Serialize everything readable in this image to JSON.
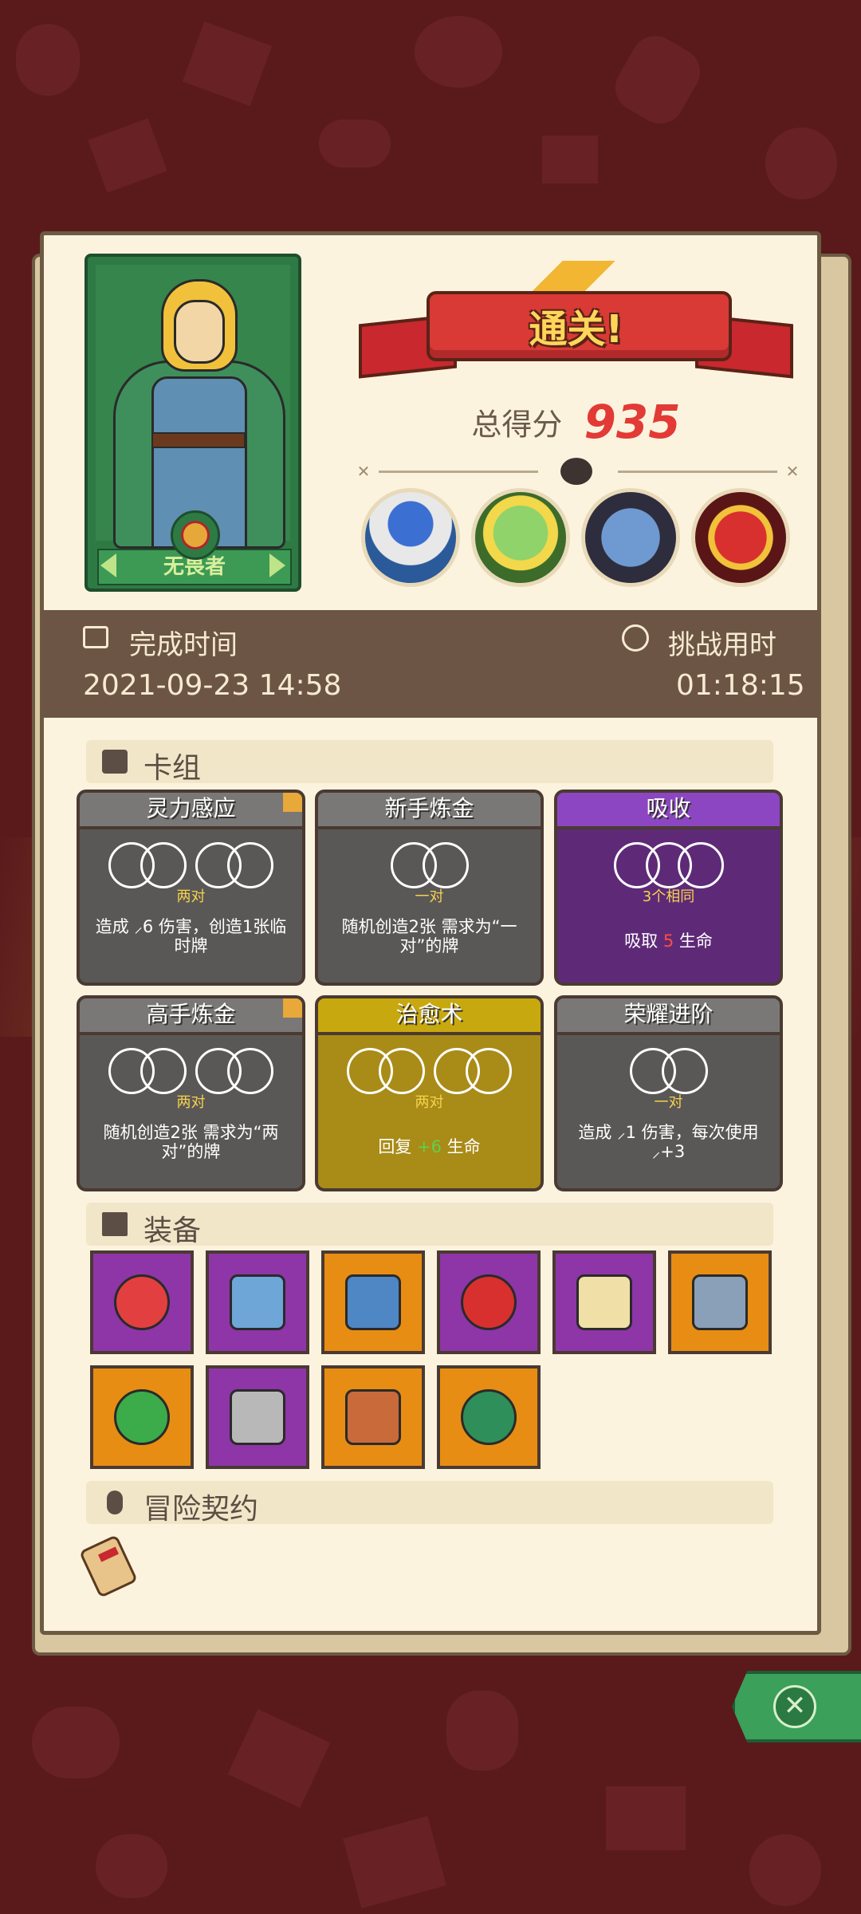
{
  "colors": {
    "background": "#5a1a1c",
    "panel": "#fcf3df",
    "accent_red": "#e23a35",
    "card_gray": "#5a5856",
    "card_purple": "#5e2a78",
    "card_gold": "#a98b17",
    "equip_purple": "#8e35a8",
    "equip_orange": "#e88d13"
  },
  "hero": {
    "name": "无畏者"
  },
  "result": {
    "banner": "通关!",
    "score_label": "总得分",
    "score_value": "935",
    "bosses": [
      "mushroom-wizard-boss",
      "green-lizard-boss",
      "blue-beast-boss",
      "red-demon-boss"
    ]
  },
  "times": {
    "finish_label": "完成时间",
    "finish_value": "2021-09-23 14:58",
    "duration_label": "挑战用时",
    "duration_value": "01:18:15"
  },
  "deck": {
    "title": "卡组",
    "cards": [
      {
        "name": "灵力感应",
        "combo": "两对",
        "desc": "造成 ⸝6 伤害，创造1张临时牌",
        "style": "gray",
        "rings": 4,
        "corner": true
      },
      {
        "name": "新手炼金",
        "combo": "一对",
        "desc": "随机创造2张 需求为“一对”的牌",
        "style": "gray",
        "rings": 2,
        "corner": false
      },
      {
        "name": "吸收",
        "combo": "3个相同",
        "desc_pre": "吸取",
        "desc_val": "5",
        "desc_post": "生命",
        "style": "purple",
        "rings": 3,
        "corner": false
      },
      {
        "name": "高手炼金",
        "combo": "两对",
        "desc": "随机创造2张 需求为“两对”的牌",
        "style": "gray",
        "rings": 4,
        "corner": true
      },
      {
        "name": "治愈术",
        "combo": "两对",
        "desc_pre": "回复",
        "desc_val": "+6",
        "desc_post": "生命",
        "style": "gold",
        "rings": 4,
        "corner": false
      },
      {
        "name": "荣耀进阶",
        "combo": "一对",
        "desc": "造成 ⸝1 伤害，每次使用 ⸝+3",
        "style": "gray",
        "rings": 2,
        "corner": false
      }
    ]
  },
  "equipment": {
    "title": "装备",
    "items": [
      {
        "icon": "heart-shield-icon",
        "rarity": "purple"
      },
      {
        "icon": "ice-dagger-icon",
        "rarity": "purple"
      },
      {
        "icon": "serrated-blade-icon",
        "rarity": "orange"
      },
      {
        "icon": "red-potion-icon",
        "rarity": "purple"
      },
      {
        "icon": "magic-mirror-icon",
        "rarity": "purple"
      },
      {
        "icon": "horn-icon",
        "rarity": "orange"
      },
      {
        "icon": "green-tome-icon",
        "rarity": "orange"
      },
      {
        "icon": "rune-shield-icon",
        "rarity": "purple"
      },
      {
        "icon": "meat-leg-icon",
        "rarity": "orange"
      },
      {
        "icon": "green-gem-icon",
        "rarity": "orange"
      }
    ]
  },
  "contract": {
    "title": "冒险契约",
    "icon": "scroll-icon"
  },
  "controls": {
    "close_icon": "close-icon"
  }
}
